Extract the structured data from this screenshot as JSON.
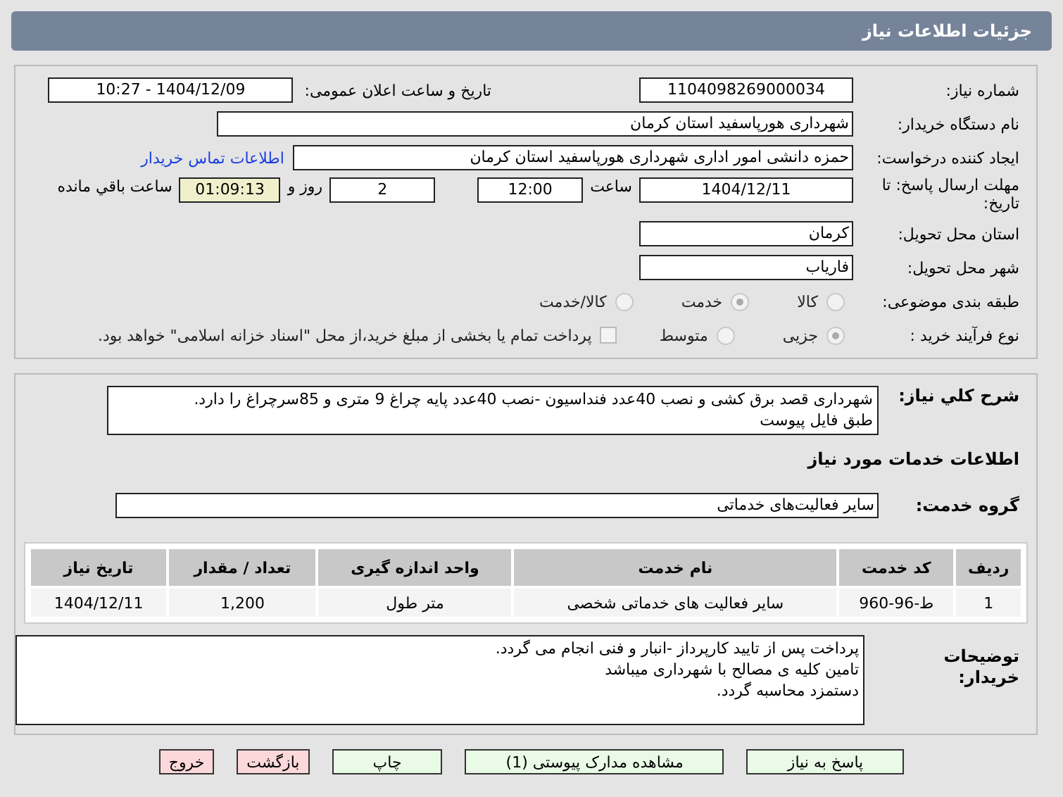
{
  "header": {
    "title": "جزئیات اطلاعات نیاز"
  },
  "need_number": {
    "label": "شماره نیاز:",
    "value": "1104098269000034"
  },
  "announce": {
    "label": "تاریخ و ساعت اعلان عمومی:",
    "value": "1404/12/09 - 10:27"
  },
  "buyer": {
    "label": "نام دستگاه خریدار:",
    "value": "شهرداری هورپاسفید استان کرمان"
  },
  "requester": {
    "label": "ایجاد کننده درخواست:",
    "value": "حمزه دانشی امور اداری شهرداری هورپاسفید استان کرمان",
    "link": "اطلاعات تماس خریدار"
  },
  "deadline": {
    "label": "مهلت ارسال پاسخ: تا تاریخ:",
    "date": "1404/12/11",
    "time_label": "ساعت",
    "time": "12:00",
    "days": "2",
    "days_label": "روز و",
    "remaining": "01:09:13",
    "remaining_label": "ساعت باقي مانده"
  },
  "province": {
    "label": "استان محل تحویل:",
    "value": "کرمان"
  },
  "city": {
    "label": "شهر محل تحویل:",
    "value": "فاریاب"
  },
  "category": {
    "label": "طبقه بندی موضوعی:",
    "options": [
      {
        "label": "کالا",
        "selected": false
      },
      {
        "label": "خدمت",
        "selected": true
      },
      {
        "label": "کالا/خدمت",
        "selected": false
      }
    ]
  },
  "process": {
    "label": "نوع فرآیند خرید :",
    "options": [
      {
        "label": "جزیی",
        "selected": true
      },
      {
        "label": "متوسط",
        "selected": false
      }
    ],
    "treasury": {
      "checked": false,
      "text": "پرداخت تمام یا بخشی از مبلغ خرید،از محل \"اسناد خزانه اسلامی\" خواهد بود."
    }
  },
  "description": {
    "label": "شرح کلي نياز:",
    "value": "شهرداری قصد برق کشی و نصب 40عدد فنداسیون -نصب 40عدد پایه چراغ 9 متری و 85سرچراغ را دارد.\nطبق فایل پیوست"
  },
  "services_title": "اطلاعات خدمات مورد نیاز",
  "service_group": {
    "label": "گروه خدمت:",
    "value": "سایر فعالیت‌های خدماتی"
  },
  "table": {
    "columns": [
      "ردیف",
      "کد خدمت",
      "نام خدمت",
      "واحد اندازه گیری",
      "تعداد / مقدار",
      "تاریخ نیاز"
    ],
    "rows": [
      [
        "1",
        "ط-96-960",
        "سایر فعالیت های خدماتی شخصی",
        "متر طول",
        "1,200",
        "1404/12/11"
      ]
    ]
  },
  "buyer_notes": {
    "label": "توضیحات خریدار:",
    "value": "پرداخت پس از تایید کارپرداز -انبار و فنی انجام  می گردد.\nتامین کلیه ی مصالح با شهرداری میباشد\nدستمزد محاسبه گردد."
  },
  "buttons": [
    {
      "label": "پاسخ به نیاز",
      "kind": "action"
    },
    {
      "label": "مشاهده مدارک پیوستی (1)",
      "kind": "action"
    },
    {
      "label": "چاپ",
      "kind": "action"
    },
    {
      "label": "بازگشت",
      "kind": "exit"
    },
    {
      "label": "خروج",
      "kind": "exit"
    }
  ]
}
